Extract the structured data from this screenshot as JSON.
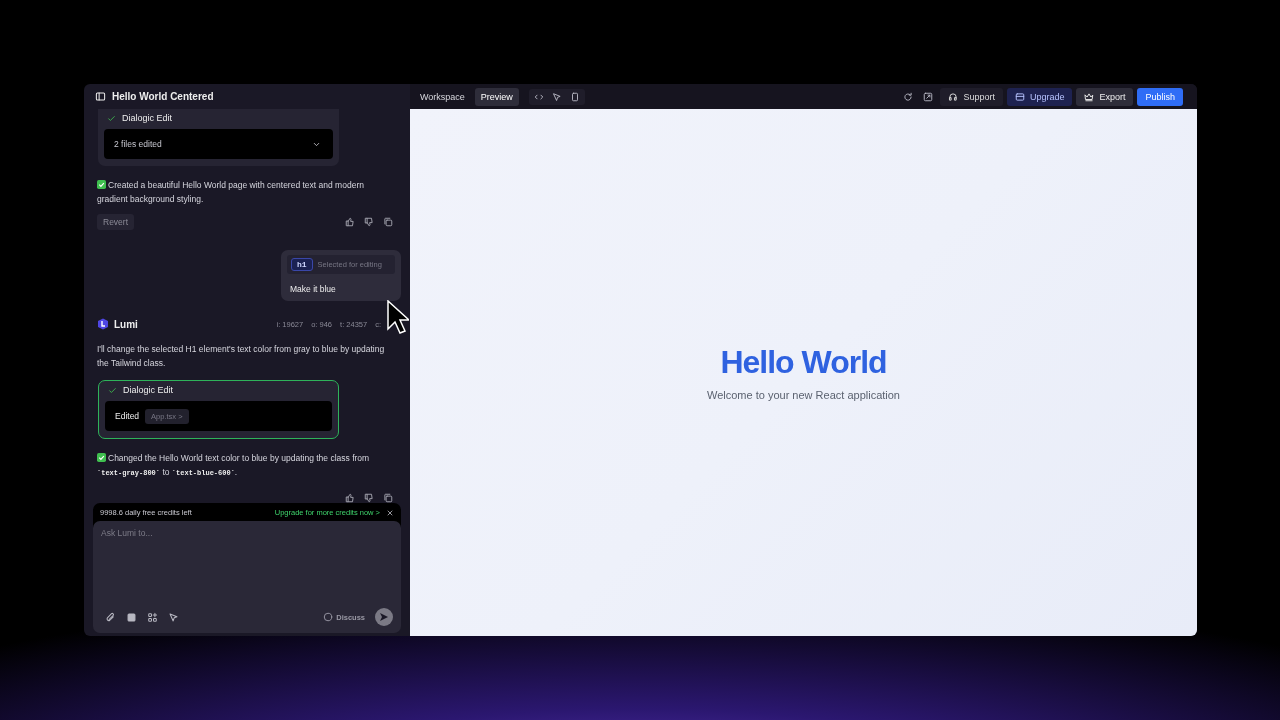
{
  "window": {
    "title": "Hello World Centered"
  },
  "toolbar": {
    "tabs": [
      {
        "label": "Workspace",
        "selected": false
      },
      {
        "label": "Preview",
        "selected": true
      }
    ],
    "support": "Support",
    "upgrade": "Upgrade",
    "export": "Export",
    "publish": "Publish"
  },
  "first_edit": {
    "title": "Dialogic Edit",
    "files": "2 files edited"
  },
  "first_reply": {
    "text": "Created a beautiful Hello World page with centered text and modern gradient background styling.",
    "revert": "Revert"
  },
  "user_message": {
    "tag": "h1",
    "tag_note": "Selected for editing",
    "text": "Make it blue"
  },
  "assistant": {
    "name": "Lumi",
    "stats": [
      "i: 19627",
      "o: 946",
      "t: 24357",
      "c:"
    ],
    "text": "I'll change the selected H1 element's text color from gray to blue by updating the Tailwind class.",
    "edit": {
      "title": "Dialogic Edit",
      "label": "Edited",
      "file": "App.tsx >"
    },
    "result": [
      {
        "kind": "text",
        "text": "Changed the Hello World text color to blue by updating the class from "
      },
      {
        "kind": "code",
        "text": "`text-gray-800`"
      },
      {
        "kind": "text",
        "text": " to "
      },
      {
        "kind": "code",
        "text": "`text-blue-600`"
      },
      {
        "kind": "text",
        "text": "."
      }
    ]
  },
  "composer": {
    "credits": "9998.6 daily free credits left",
    "upgrade_link": "Upgrade for more credits now >",
    "placeholder": "Ask Lumi to...",
    "discuss": "Discuss"
  },
  "preview": {
    "heading": "Hello World",
    "subtitle": "Welcome to your new React application"
  }
}
